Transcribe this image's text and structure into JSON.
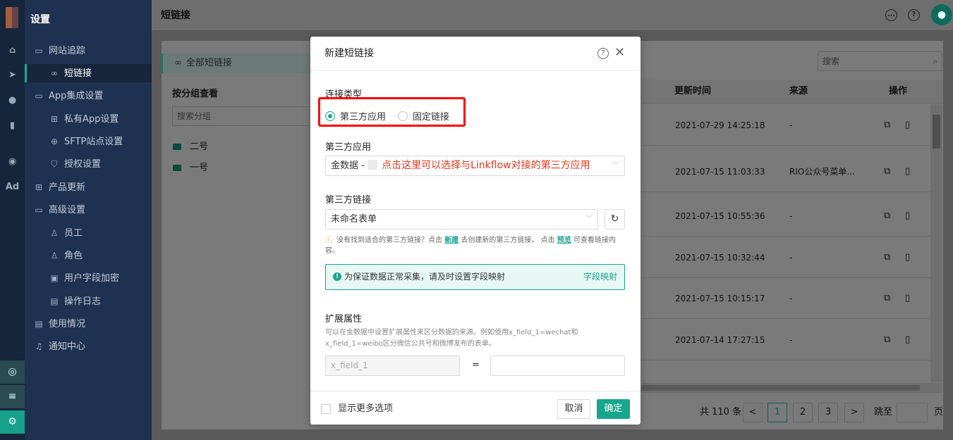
{
  "app": {
    "settings_title": "设置",
    "page_title": "短链接"
  },
  "sidebar": {
    "items": [
      {
        "label": "网站追踪",
        "icon": "folder-icon"
      },
      {
        "label": "短链接",
        "icon": "link-icon"
      },
      {
        "label": "App集成设置",
        "icon": "folder-icon"
      },
      {
        "label": "私有App设置",
        "icon": "grid-icon"
      },
      {
        "label": "SFTP站点设置",
        "icon": "globe-icon"
      },
      {
        "label": "授权设置",
        "icon": "shield-icon"
      },
      {
        "label": "产品更新",
        "icon": "grid-icon"
      },
      {
        "label": "高级设置",
        "icon": "folder-icon"
      },
      {
        "label": "员工",
        "icon": "user-icon"
      },
      {
        "label": "角色",
        "icon": "user-group-icon"
      },
      {
        "label": "用户字段加密",
        "icon": "lock-doc-icon"
      },
      {
        "label": "操作日志",
        "icon": "log-icon"
      },
      {
        "label": "使用情况",
        "icon": "chart-doc-icon"
      },
      {
        "label": "通知中心",
        "icon": "bell-icon"
      }
    ]
  },
  "rail": {
    "ad_label": "Ad"
  },
  "left_panel": {
    "tab": "全部短链接",
    "group_title": "按分组查看",
    "group_search_placeholder": "搜索分组",
    "groups": [
      "二号",
      "一号"
    ]
  },
  "table": {
    "search_placeholder": "搜索",
    "columns": {
      "updated": "更新时间",
      "source": "来源",
      "actions": "操作"
    },
    "rows": [
      {
        "updated": "2021-07-29 14:25:18",
        "source": "-"
      },
      {
        "updated": "2021-07-15 11:03:33",
        "source": "RIO公众号菜单..."
      },
      {
        "updated": "2021-07-15 10:55:36",
        "source": "-"
      },
      {
        "updated": "2021-07-15 10:32:44",
        "source": "-"
      },
      {
        "updated": "2021-07-15 10:15:17",
        "source": "-"
      },
      {
        "updated": "2021-07-14 17:27:15",
        "source": "-"
      }
    ]
  },
  "pager": {
    "total": "共 110 条",
    "pages": [
      "1",
      "2",
      "3"
    ],
    "jump_prefix": "跳至",
    "jump_suffix": "页",
    "prev": "<",
    "next": ">"
  },
  "modal": {
    "title": "新建短链接",
    "link_type_label": "连接类型",
    "option_third_party": "第三方应用",
    "option_fixed": "固定链接",
    "app_label": "第三方应用",
    "app_value": "金数据 -",
    "annotation": "点击这里可以选择与Linkflow对接的第三方应用",
    "link_label": "第三方链接",
    "link_value": "未命名表单",
    "hint_prefix": "没有找到适合的第三方链接？点击",
    "hint_new": "新建",
    "hint_mid": "去创建新的第三方链接。 点击",
    "hint_preview": "预览",
    "hint_suffix": "可查看链接内容。",
    "notice_text": "为保证数据正常采集，请及时设置字段映射",
    "notice_action": "字段映射",
    "ext_label": "扩展属性",
    "ext_desc": "可以在金数据中设置扩展属性来区分数据的来源。例如使用x_field_1=wechat和x_field_1=weibo区分微信公共号和微博发布的表单。",
    "ext_key_placeholder": "x_field_1",
    "eq": "=",
    "more_options": "显示更多选项",
    "cancel": "取消",
    "confirm": "确定"
  }
}
